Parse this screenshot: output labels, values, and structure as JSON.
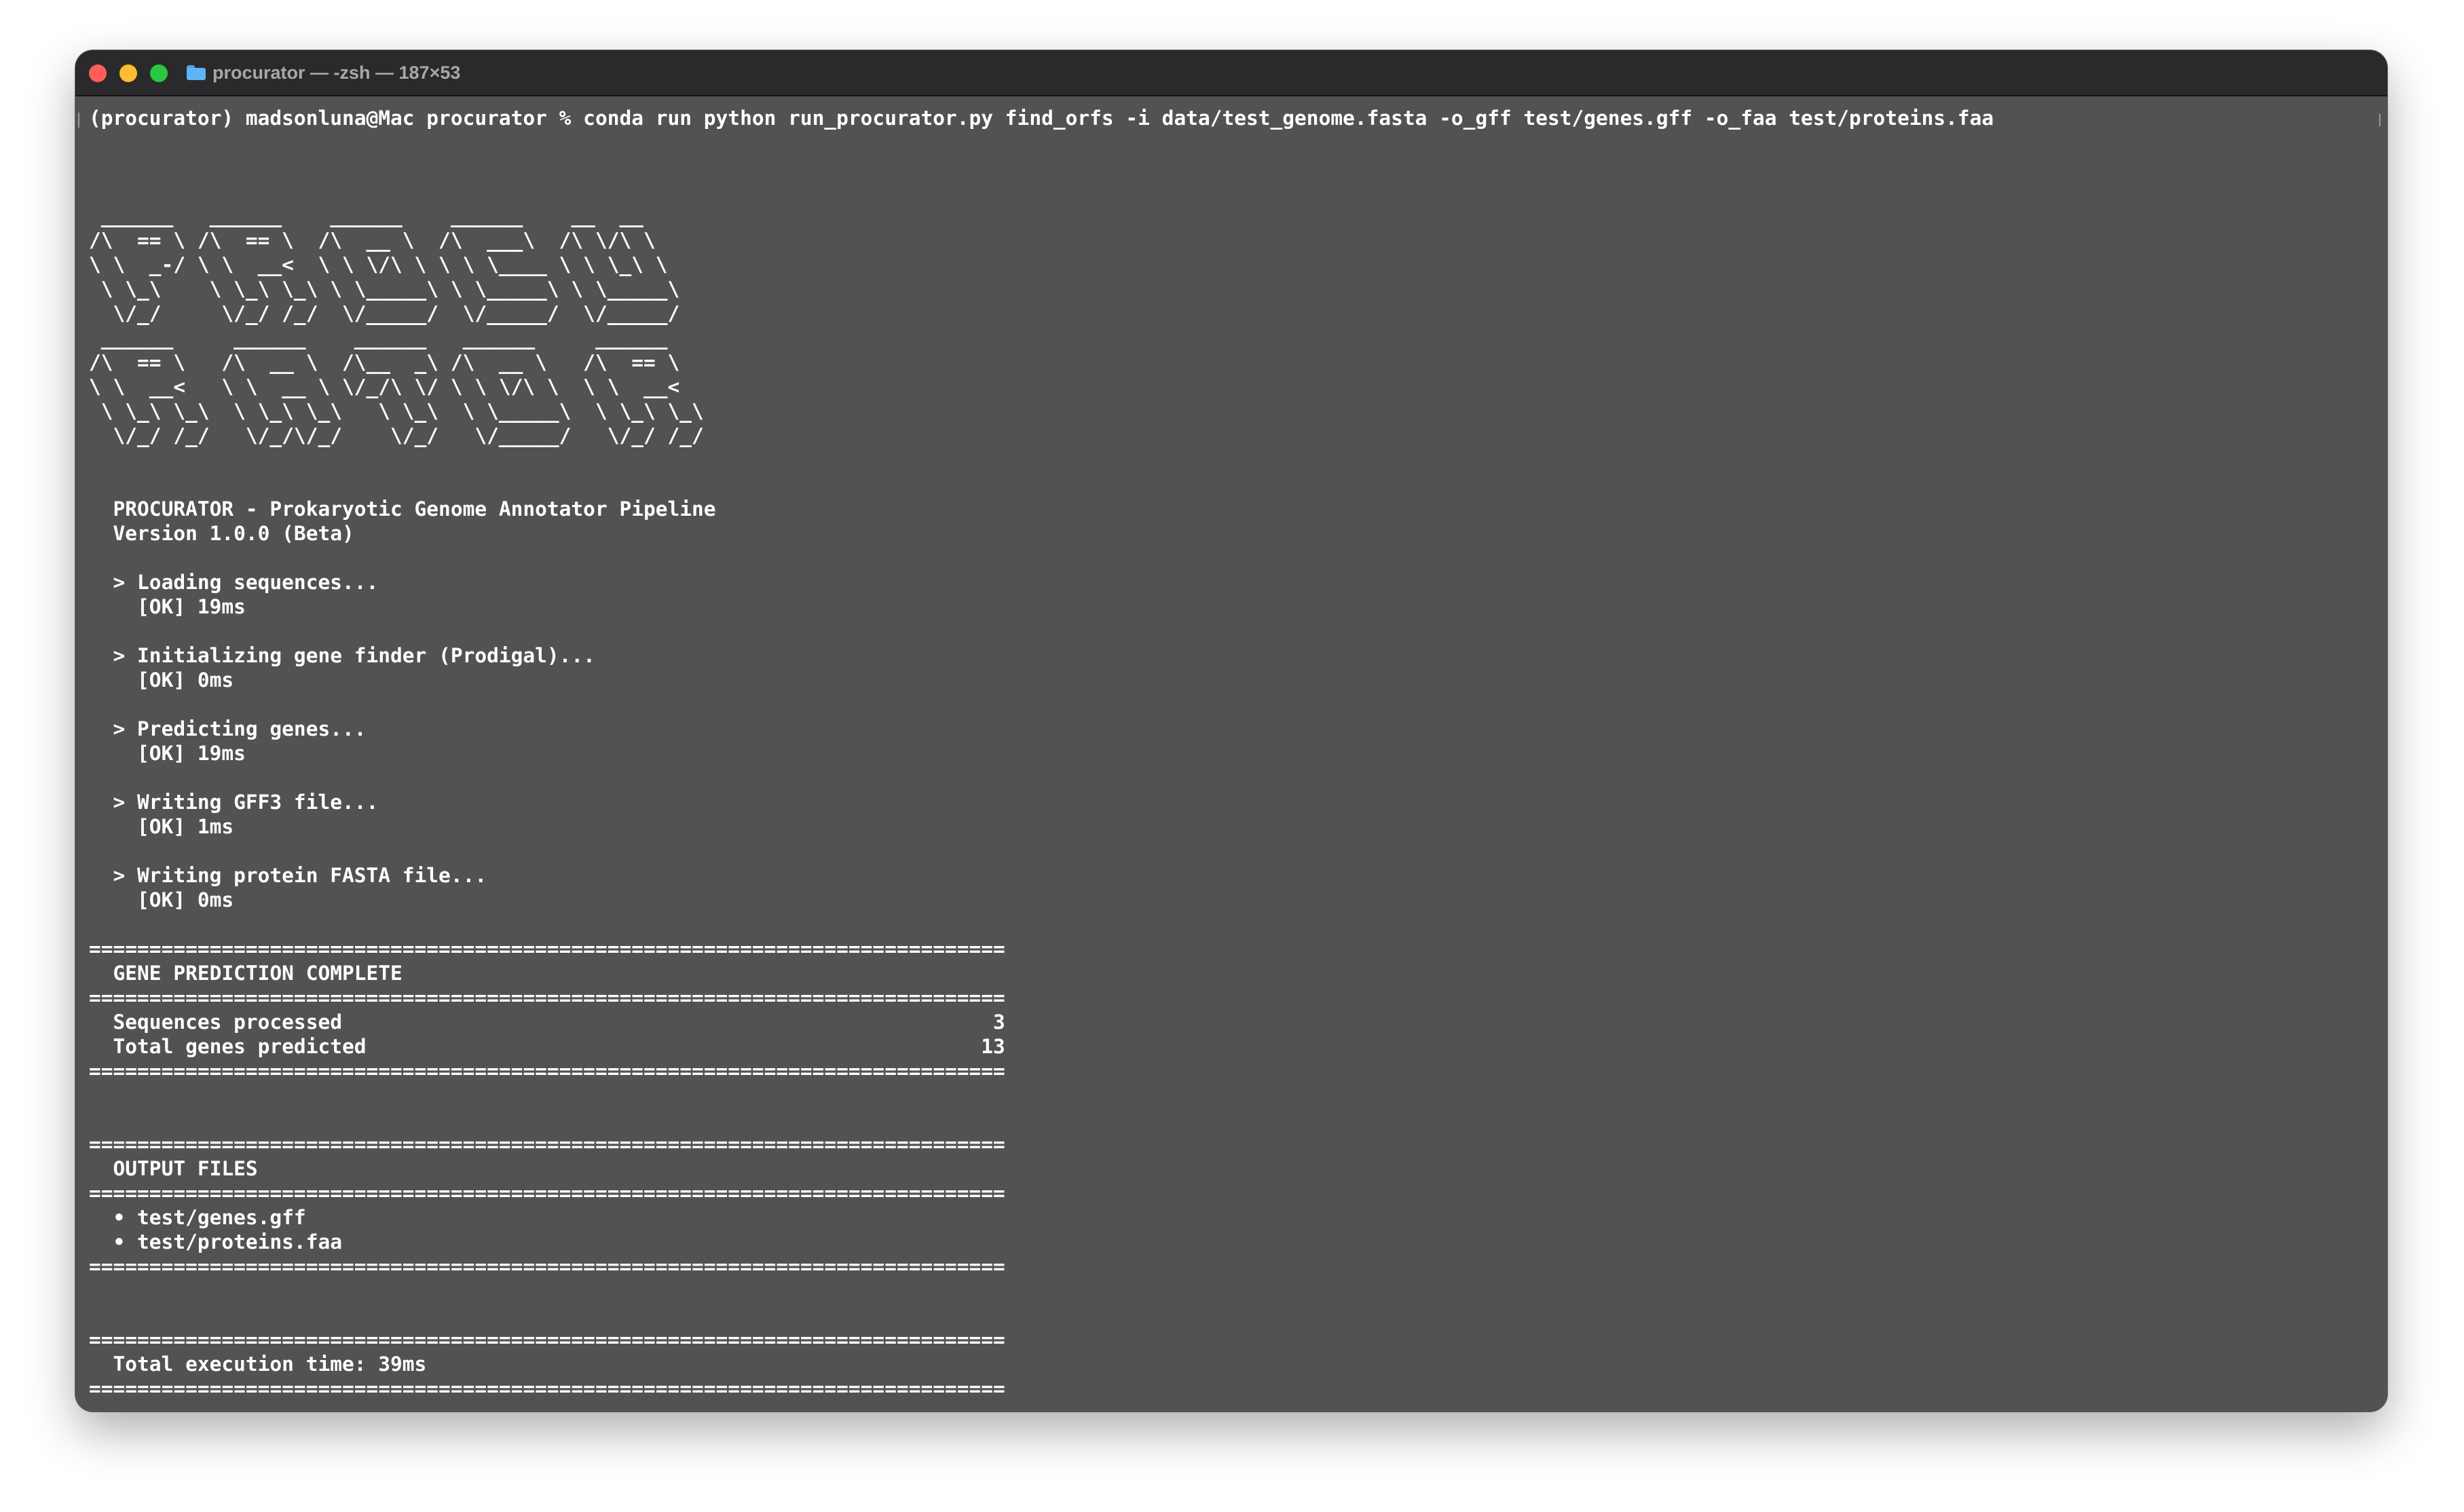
{
  "window": {
    "title": "procurator — -zsh — 187×53",
    "folder_icon": "folder-icon"
  },
  "terminal": {
    "command_line": "(procurator) madsonluna@Mac procurator % conda run python run_procurator.py find_orfs -i data/test_genome.fasta -o_gff test/genes.gff -o_faa test/proteins.faa",
    "ascii_art": [
      " ______   ______    ______    ______    __  __",
      "/\\  == \\ /\\  == \\  /\\  __ \\  /\\  ___\\  /\\ \\/\\ \\",
      "\\ \\  _-/ \\ \\  __<  \\ \\ \\/\\ \\ \\ \\ \\____ \\ \\ \\_\\ \\",
      " \\ \\_\\    \\ \\_\\ \\_\\ \\ \\_____\\ \\ \\_____\\ \\ \\_____\\",
      "  \\/_/     \\/_/ /_/  \\/_____/  \\/_____/  \\/_____/",
      " ______     ______    ______   ______     ______",
      "/\\  == \\   /\\  __ \\  /\\__  _\\ /\\  __ \\   /\\  == \\",
      "\\ \\  __<   \\ \\  __ \\ \\/_/\\ \\/ \\ \\ \\/\\ \\  \\ \\  __<",
      " \\ \\_\\ \\_\\  \\ \\_\\ \\_\\   \\ \\_\\  \\ \\_____\\  \\ \\_\\ \\_\\",
      "  \\/_/ /_/   \\/_/\\/_/    \\/_/   \\/_____/   \\/_/ /_/"
    ],
    "header_title": "  PROCURATOR - Prokaryotic Genome Annotator Pipeline",
    "header_version": "  Version 1.0.0 (Beta)",
    "steps": [
      {
        "label": "  > Loading sequences...",
        "result": "    [OK] 19ms"
      },
      {
        "label": "  > Initializing gene finder (Prodigal)...",
        "result": "    [OK] 0ms"
      },
      {
        "label": "  > Predicting genes...",
        "result": "    [OK] 19ms"
      },
      {
        "label": "  > Writing GFF3 file...",
        "result": "    [OK] 1ms"
      },
      {
        "label": "  > Writing protein FASTA file...",
        "result": "    [OK] 0ms"
      }
    ],
    "rule": "============================================================================",
    "prediction": {
      "title": "  GENE PREDICTION COMPLETE",
      "rows": [
        "  Sequences processed                                                      3",
        "  Total genes predicted                                                   13"
      ]
    },
    "output_files": {
      "title": "  OUTPUT FILES",
      "files": [
        "  • test/genes.gff",
        "  • test/proteins.faa"
      ]
    },
    "execution": {
      "title": "  Total execution time: 39ms"
    }
  },
  "colors": {
    "terminal_bg": "#525252",
    "titlebar_bg": "#2a2a2c",
    "text": "#ffffff",
    "close": "#ff5f57",
    "minimize": "#febc2e",
    "maximize": "#28c840"
  }
}
